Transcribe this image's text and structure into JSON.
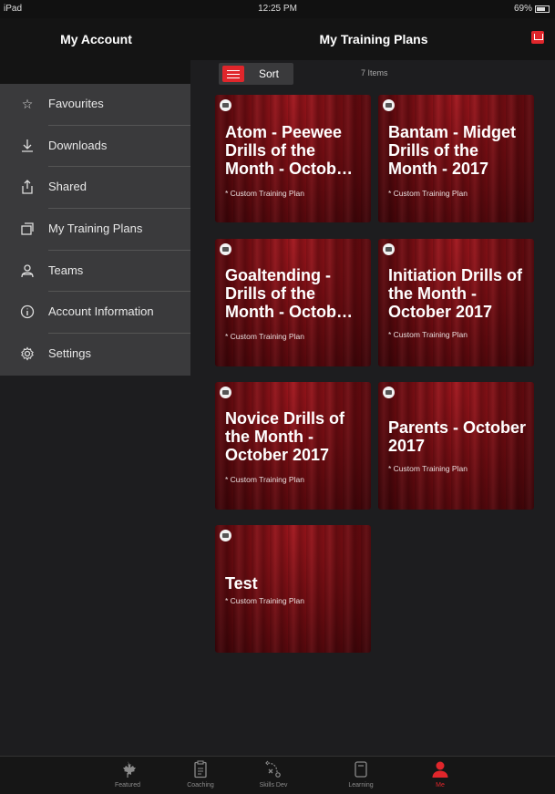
{
  "status_bar": {
    "device": "iPad",
    "time": "12:25 PM",
    "battery": "69%"
  },
  "header": {
    "left_title": "My Account",
    "title": "My Training Plans"
  },
  "sidebar": {
    "items": [
      {
        "label": "Favourites",
        "icon": "star-icon"
      },
      {
        "label": "Downloads",
        "icon": "download-icon"
      },
      {
        "label": "Shared",
        "icon": "share-icon"
      },
      {
        "label": "My Training Plans",
        "icon": "plans-icon"
      },
      {
        "label": "Teams",
        "icon": "teams-icon"
      },
      {
        "label": "Account Information",
        "icon": "info-icon"
      },
      {
        "label": "Settings",
        "icon": "gear-icon"
      }
    ]
  },
  "toolbar": {
    "sort_label": "Sort",
    "items_count": "7 Items"
  },
  "cards": [
    {
      "title": "Atom - Peewee Drills of the Month - Octob…",
      "subtitle": "* Custom Training Plan"
    },
    {
      "title": "Bantam - Midget Drills of the Month - 2017",
      "subtitle": "* Custom Training Plan"
    },
    {
      "title": "Goaltending - Drills of the Month - Octob…",
      "subtitle": "* Custom Training Plan"
    },
    {
      "title": "Initiation Drills of the Month - October 2017",
      "subtitle": "* Custom Training Plan"
    },
    {
      "title": "Novice Drills of the Month - October 2017",
      "subtitle": "* Custom Training Plan"
    },
    {
      "title": "Parents - October 2017",
      "subtitle": "* Custom Training Plan"
    },
    {
      "title": "Test",
      "subtitle": "* Custom Training Plan"
    }
  ],
  "tabbar": {
    "items": [
      {
        "label": "Featured",
        "icon": "maple-leaf-icon"
      },
      {
        "label": "Coaching",
        "icon": "clipboard-icon"
      },
      {
        "label": "Skills Dev",
        "icon": "play-diagram-icon"
      },
      {
        "label": "Learning",
        "icon": "tablet-icon"
      },
      {
        "label": "Me",
        "icon": "person-icon"
      }
    ]
  },
  "colors": {
    "accent": "#e0262b",
    "background": "#1d1d1f",
    "sidebar": "#3a3a3c",
    "card": "#7a0c12"
  }
}
